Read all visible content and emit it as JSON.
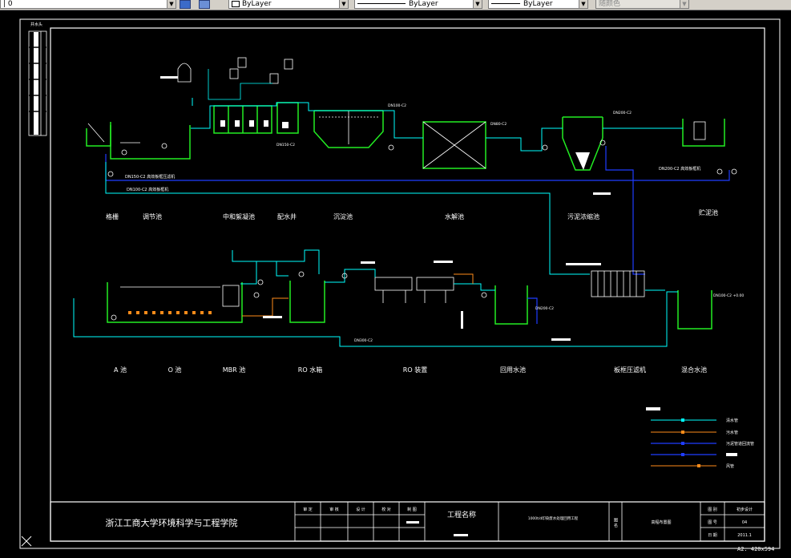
{
  "toolbar": {
    "layer_value": "| 0",
    "color_value": "ByLayer",
    "linetype_value": "ByLayer",
    "lineweight_value": "ByLayer",
    "plotstyle_value": "随颜色"
  },
  "drawing": {
    "corner_label": "井水头",
    "top_labels": [
      "格栅",
      "调节池",
      "中和絮凝池",
      "配水井",
      "沉淀池",
      "水解池",
      "污泥浓缩池",
      "贮泥池"
    ],
    "bottom_labels": [
      "A 池",
      "O 池",
      "MBR 池",
      "RO 水箱",
      "RO 装置",
      "回用水池",
      "板框压滤机",
      "混合水池"
    ],
    "pipe_notes": {
      "dn150": "DN150-C2  高效板框压滤机",
      "dn100": "DN100-C2  高效板框机",
      "dn200_right": "DN200-C2  高效板框机",
      "dn300": "DN300-C2",
      "dn200_bottom": "DN200-C2",
      "dn100_mixed": "DN100-C2 +0.00",
      "pipe_small_1": "DN100-C2",
      "pipe_small_2": "DN80-C2",
      "pipe_small_3": "DN150-C2",
      "pipe_small_4": "DN200-C2"
    },
    "legend": [
      "清水管",
      "污水管",
      "污泥管道回流管",
      "",
      "风管"
    ],
    "legend_colors": [
      "#00ffff",
      "#ff8c1a",
      "#1f3cff",
      "#1f3cff",
      "#ff8c1a"
    ]
  },
  "title_block": {
    "institution": "浙江工商大学环境科学与工程学院",
    "row1_cells": [
      "审 定",
      "审 核",
      "设 计",
      "校 对",
      "制 图"
    ],
    "project_label": "工程名称",
    "project_name": "1000t/d印染废水处理回用工程",
    "drawing_col_label": "图 名",
    "drawing_title": "高程布置图",
    "right_labels": [
      "图 别",
      "图 号",
      "日 期"
    ],
    "right_values": [
      "初步设计",
      "04",
      "2011.1"
    ],
    "sheet_size": "A2: 420x594"
  },
  "colors": {
    "frame": "#ffffff",
    "clean_pipe": "#00ffff",
    "sewage_pipe": "#ff8c1a",
    "sludge_pipe": "#1f3cff",
    "tank": "#22ee22"
  }
}
